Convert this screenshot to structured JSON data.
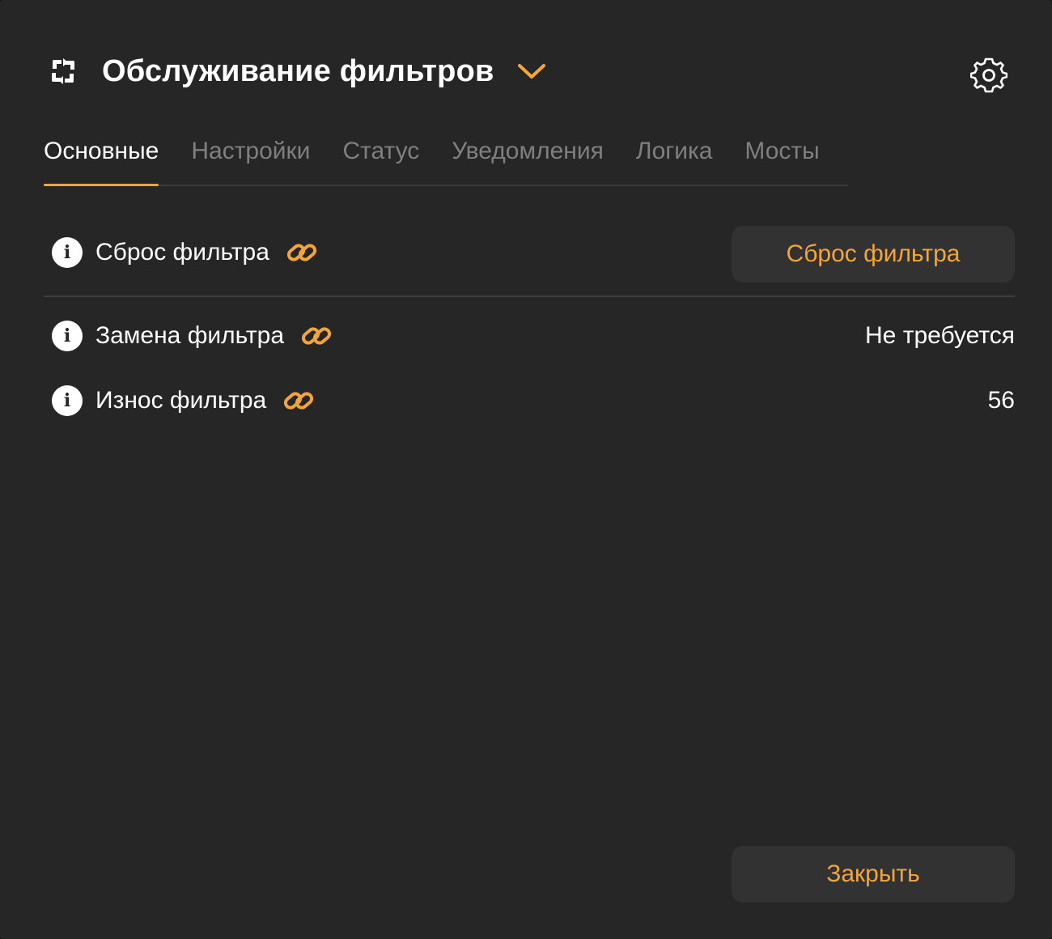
{
  "header": {
    "icon": "sync-arrows-icon",
    "title": "Обслуживание фильтров",
    "dropdown_icon": "chevron-down-icon",
    "settings_icon": "gear-icon"
  },
  "tabs": [
    {
      "label": "Основные",
      "active": true
    },
    {
      "label": "Настройки",
      "active": false
    },
    {
      "label": "Статус",
      "active": false
    },
    {
      "label": "Уведомления",
      "active": false
    },
    {
      "label": "Логика",
      "active": false
    },
    {
      "label": "Мосты",
      "active": false
    }
  ],
  "rows": {
    "reset": {
      "label": "Сброс фильтра",
      "button_label": "Сброс фильтра"
    },
    "replace": {
      "label": "Замена фильтра",
      "value": "Не требуется"
    },
    "wear": {
      "label": "Износ фильтра",
      "value": "56"
    }
  },
  "footer": {
    "close_label": "Закрыть"
  },
  "colors": {
    "background": "#262626",
    "accent": "#f3a53a",
    "button_bg": "#323232",
    "muted_text": "#7f7f7f",
    "divider": "#3e3e3e"
  }
}
